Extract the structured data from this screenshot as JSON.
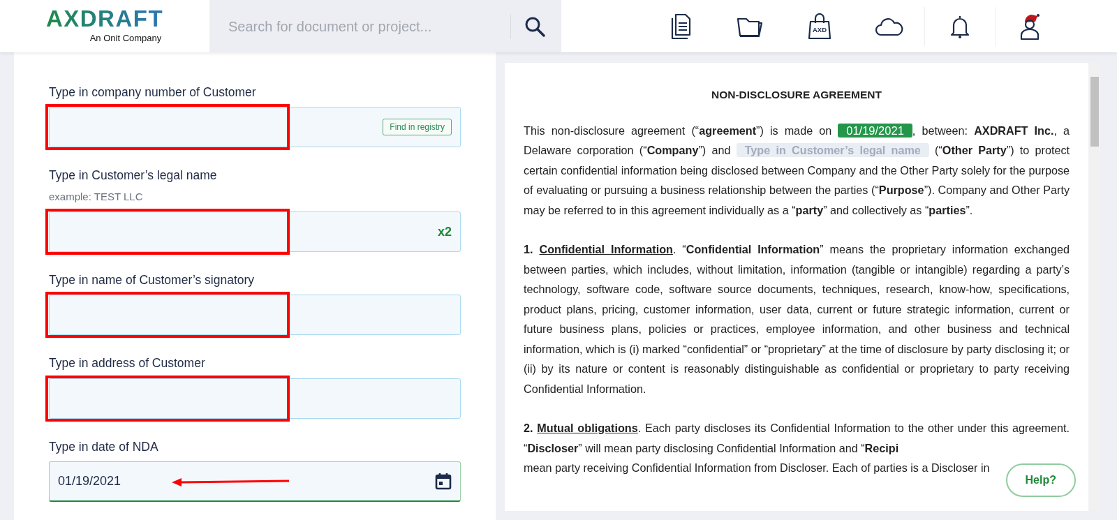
{
  "header": {
    "logo": {
      "name": "AXDRAFT",
      "tagline": "An Onit Company"
    },
    "search": {
      "placeholder": "Search for document or project..."
    },
    "store_label": "AXD"
  },
  "form": {
    "fields": [
      {
        "label": "Type in company number of Customer",
        "kind": "text",
        "highlighted": true,
        "action": "Find in registry"
      },
      {
        "label": "Type in Customer’s legal name",
        "hint": "example: TEST LLC",
        "kind": "text",
        "highlighted": true,
        "counter": "x2"
      },
      {
        "label": "Type in name of Customer’s signatory",
        "kind": "text",
        "highlighted": true
      },
      {
        "label": "Type in address of Customer",
        "kind": "text",
        "highlighted": true
      },
      {
        "label": "Type in date of NDA",
        "kind": "date",
        "value": "01/19/2021",
        "highlighted": false,
        "arrow": true,
        "valid": true
      }
    ]
  },
  "document": {
    "title": "NON-DISCLOSURE AGREEMENT",
    "paragraphs": [
      [
        {
          "kind": "text",
          "text": "This non-disclosure agreement (“**agreement**”) is made on "
        },
        {
          "kind": "chip",
          "text": "01/19/2021",
          "filled": true
        },
        {
          "kind": "text",
          "text": ", between: **AXDRAFT Inc.**, a Delaware corporation (“**Company**”) and "
        },
        {
          "kind": "chip",
          "text": "Type in Customer’s legal name",
          "filled": false
        },
        {
          "kind": "text",
          "text": " (“**Other Party**”) to protect certain confidential information being disclosed between Company and the Other Party solely for the purpose of evaluating or pursuing a business relationship between the parties (“**Purpose**”). Company and Other Party may be referred to in this agreement individually as a “**party**” and collectively as “**parties**”."
        }
      ],
      [
        {
          "kind": "number",
          "text": "1."
        },
        {
          "kind": "heading",
          "text": "Confidential Information"
        },
        {
          "kind": "text",
          "text": ". “**Confidential Information**” means the proprietary information exchanged between parties, which includes, without limitation, information (tangible or intangible) regarding a party’s technology, software code, software source documents, techniques, research, know-how, specifications, product plans, pricing, customer information, user data, current or future strategic information, current or future business plans, policies or practices, employee information, and other business and technical information, which is (i) marked “confidential” or “proprietary” at the time of disclosure by party disclosing it; or (ii) by its nature or content is reasonably distinguishable as confidential or proprietary to party receiving Confidential Information."
        }
      ],
      [
        {
          "kind": "number",
          "text": "2."
        },
        {
          "kind": "heading",
          "text": "Mutual obligations"
        },
        {
          "kind": "text",
          "text": ". Each party discloses its Confidential Information to the other under this agreement. “**Discloser**” will mean party disclosing Confidential Information and “**Recipi**"
        },
        {
          "kind": "break"
        },
        {
          "kind": "text",
          "text": "mean party receiving Confidential Information from Discloser. Each of parties is a Discloser in"
        }
      ]
    ]
  },
  "help_button": "Help?"
}
